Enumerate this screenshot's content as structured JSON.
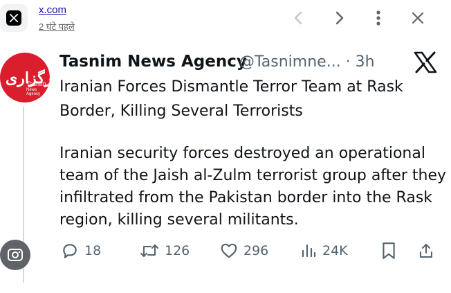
{
  "source": {
    "domain": "x.com",
    "time_ago": "2 घंटे पहले"
  },
  "avatar": {
    "line1": "خبرگزاری",
    "line2": "Tasnim",
    "line3": "News Agency"
  },
  "tweet": {
    "author": "Tasnim News Agency",
    "handle_time": "@Tasnimne... · 3h",
    "headline": "Iranian Forces Dismantle Terror Team at Rask Border, Killing Several Terrorists",
    "body": "Iranian security forces destroyed an operational team of the Jaish al-Zulm terrorist group after they infiltrated from the Pakistan border into the Rask region, killing several militants."
  },
  "actions": {
    "replies": "18",
    "reposts": "126",
    "likes": "296",
    "views": "24K"
  },
  "colors": {
    "link": "#1a0dab",
    "muted": "#536471",
    "avatar_bg": "#d91e2e"
  },
  "icons": [
    "x-logo-icon",
    "chevron-left-icon",
    "chevron-right-icon",
    "more-vertical-icon",
    "close-icon",
    "x-brand-icon",
    "reply-icon",
    "repost-icon",
    "like-icon",
    "views-icon",
    "bookmark-icon",
    "share-icon",
    "lens-icon"
  ]
}
